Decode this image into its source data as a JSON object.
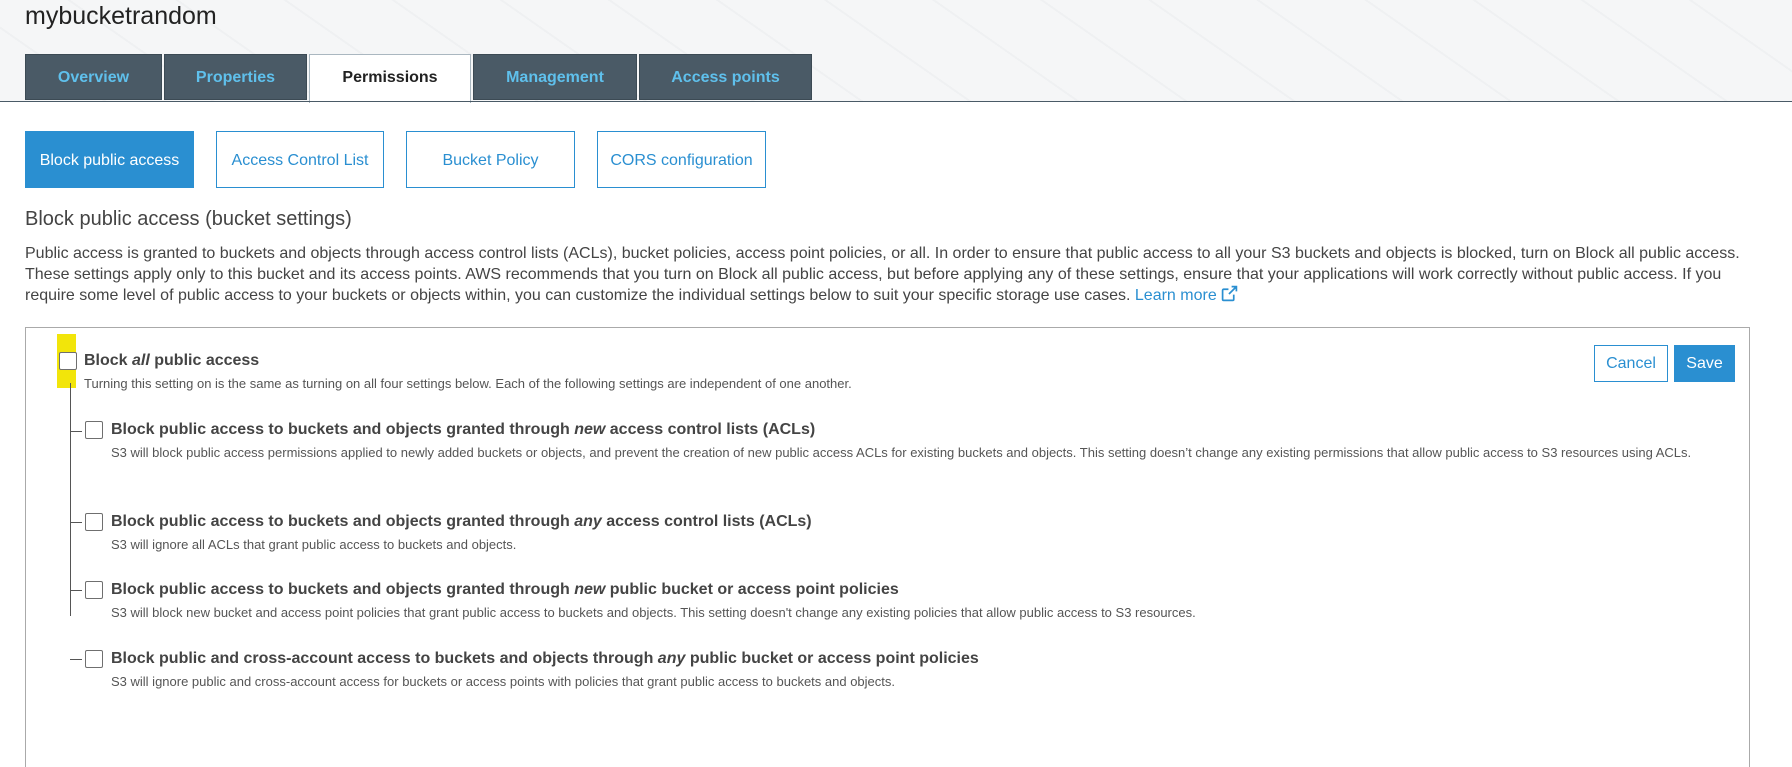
{
  "bucket_name": "mybucketrandom",
  "tabs": [
    {
      "label": "Overview"
    },
    {
      "label": "Properties"
    },
    {
      "label": "Permissions"
    },
    {
      "label": "Management"
    },
    {
      "label": "Access points"
    }
  ],
  "active_tab": "Permissions",
  "subtabs": [
    {
      "label": "Block public access"
    },
    {
      "label": "Access Control List"
    },
    {
      "label": "Bucket Policy"
    },
    {
      "label": "CORS configuration"
    }
  ],
  "active_subtab": "Block public access",
  "section": {
    "heading": "Block public access (bucket settings)",
    "description": "Public access is granted to buckets and objects through access control lists (ACLs), bucket policies, access point policies, or all. In order to ensure that public access to all your S3 buckets and objects is blocked, turn on Block all public access. These settings apply only to this bucket and its access points. AWS recommends that you turn on Block all public access, but before applying any of these settings, ensure that your applications will work correctly without public access. If you require some level of public access to your buckets or objects within, you can customize the individual settings below to suit your specific storage use cases.",
    "learn_more": "Learn more"
  },
  "block_all": {
    "title_pre": "Block ",
    "title_em": "all",
    "title_post": " public access",
    "description": "Turning this setting on is the same as turning on all four settings below. Each of the following settings are independent of one another.",
    "checked": false
  },
  "options": [
    {
      "title_pre": "Block public access to buckets and objects granted through ",
      "title_em": "new",
      "title_post": " access control lists (ACLs)",
      "description": "S3 will block public access permissions applied to newly added buckets or objects, and prevent the creation of new public access ACLs for existing buckets and objects. This setting doesn’t change any existing permissions that allow public access to S3 resources using ACLs.",
      "checked": false
    },
    {
      "title_pre": "Block public access to buckets and objects granted through ",
      "title_em": "any",
      "title_post": " access control lists (ACLs)",
      "description": "S3 will ignore all ACLs that grant public access to buckets and objects.",
      "checked": false
    },
    {
      "title_pre": "Block public access to buckets and objects granted through ",
      "title_em": "new",
      "title_post": " public bucket or access point policies",
      "description": "S3 will block new bucket and access point policies that grant public access to buckets and objects. This setting doesn't change any existing policies that allow public access to S3 resources.",
      "checked": false
    },
    {
      "title_pre": "Block public and cross-account access to buckets and objects through ",
      "title_em": "any",
      "title_post": " public bucket or access point policies",
      "description": "S3 will ignore public and cross-account access for buckets or access points with policies that grant public access to buckets and objects.",
      "checked": false
    }
  ],
  "actions": {
    "cancel": "Cancel",
    "save": "Save"
  },
  "colors": {
    "accent": "#2a8fd1",
    "tab_bg": "#4a5a66",
    "tab_text": "#5fc0ec",
    "highlight": "#f2e50a"
  }
}
